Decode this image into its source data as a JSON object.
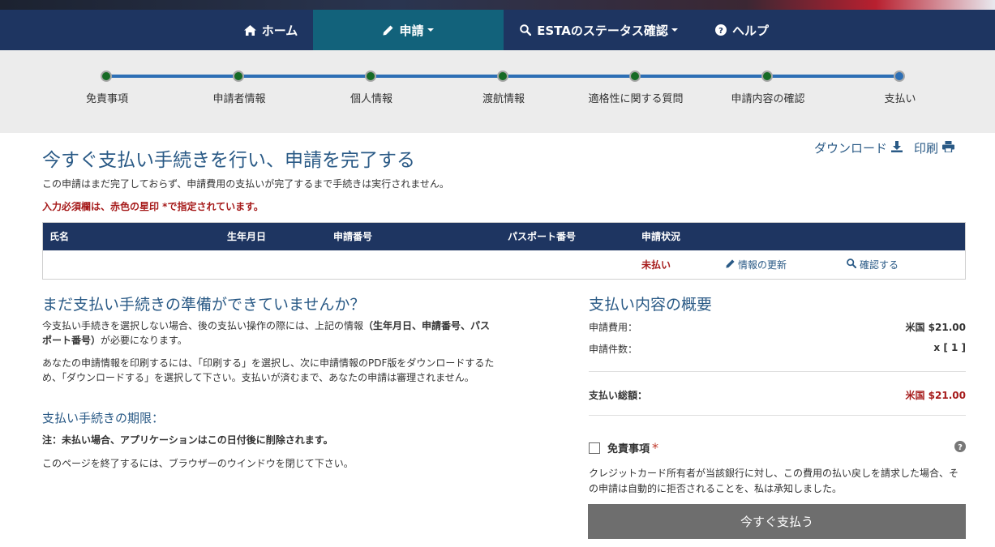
{
  "nav": {
    "home": "ホーム",
    "apply": "申請",
    "status": "ESTAのステータス確認",
    "help": "ヘルプ"
  },
  "steps": [
    "免責事項",
    "申請者情報",
    "個人情報",
    "渡航情報",
    "適格性に関する質問",
    "申請内容の確認",
    "支払い"
  ],
  "current_step": 7,
  "page": {
    "title": "今すぐ支払い手続きを行い、申請を完了する",
    "intro": "この申請はまだ完了しておらず、申請費用の支払いが完了するまで手続きは実行されません。",
    "required_note": "入力必須欄は、赤色の星印 *で指定されています。",
    "download": "ダウンロード",
    "print": "印刷"
  },
  "table": {
    "headers": [
      "氏名",
      "生年月日",
      "申請番号",
      "パスポート番号",
      "申請状況"
    ],
    "status": "未払い",
    "update_link": "情報の更新",
    "check_link": "確認する"
  },
  "left": {
    "heading": "まだ支払い手続きの準備ができていませんか？",
    "p1_a": "今支払い手続きを選択しない場合、後の支払い操作の際には、上記の情報",
    "p1_b": "（生年月日、申請番号、パスポート番号）",
    "p1_c": "が必要になります。",
    "p2": "あなたの申請情報を印刷するには、「印刷する」を選択し、次に申請情報のPDF版をダウンロードするため、「ダウンロードする」を選択して下さい。支払いが済むまで、あなたの申請は審理されません。",
    "deadline": "支払い手続きの期限：",
    "note": "注：未払い場合、アプリケーションはこの日付後に削除されます。",
    "close_note": "このページを終了するには、ブラウザーのウインドウを閉じて下さい。"
  },
  "summary": {
    "heading": "支払い内容の概要",
    "fee_label": "申請費用：",
    "fee_value": "米国 $21.00",
    "count_label": "申請件数：",
    "count_value": "x [ 1 ]",
    "total_label": "支払い総額：",
    "total_value": "米国 $21.00",
    "agree_label": "免責事項",
    "agree_star": "*",
    "agree_text": "クレジットカード所有者が当該銀行に対し、この費用の払い戻しを請求した場合、その申請は自動的に拒否されることを、私は承知しました。",
    "pay_button": "今すぐ支払う"
  },
  "colors": {
    "navbar": "#1e3561",
    "nav_active": "#12627b",
    "link": "#2a5a86",
    "alert": "#a61b1b",
    "step_done": "#166a25",
    "track": "#2d6fb5",
    "pay_button": "#6e6e6e"
  }
}
